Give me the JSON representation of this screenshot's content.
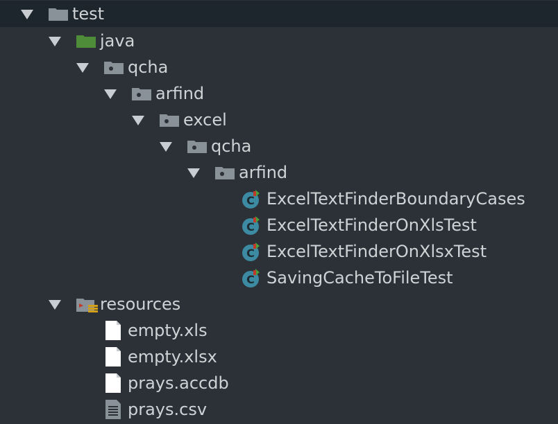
{
  "tree": {
    "items": [
      {
        "label": "test",
        "icon": "folder-icon"
      },
      {
        "label": "java",
        "icon": "source-folder-icon"
      },
      {
        "label": "qcha",
        "icon": "package-icon"
      },
      {
        "label": "arfind",
        "icon": "package-icon"
      },
      {
        "label": "excel",
        "icon": "package-icon"
      },
      {
        "label": "qcha",
        "icon": "package-icon"
      },
      {
        "label": "arfind",
        "icon": "package-icon"
      },
      {
        "label": "ExcelTextFinderBoundaryCases",
        "icon": "test-class-icon"
      },
      {
        "label": "ExcelTextFinderOnXlsTest",
        "icon": "test-class-icon"
      },
      {
        "label": "ExcelTextFinderOnXlsxTest",
        "icon": "test-class-icon"
      },
      {
        "label": "SavingCacheToFileTest",
        "icon": "test-class-icon"
      },
      {
        "label": "resources",
        "icon": "resources-folder-icon"
      },
      {
        "label": "empty.xls",
        "icon": "file-icon"
      },
      {
        "label": "empty.xlsx",
        "icon": "file-icon"
      },
      {
        "label": "prays.accdb",
        "icon": "file-icon"
      },
      {
        "label": "prays.csv",
        "icon": "text-file-icon"
      }
    ]
  },
  "colors": {
    "background": "#2b3136",
    "selected_row": "#1c262c",
    "text": "#cfd3d6",
    "folder": "#8a9299",
    "source_folder": "#4f8c3a",
    "class_icon": "#3d8aa3"
  }
}
